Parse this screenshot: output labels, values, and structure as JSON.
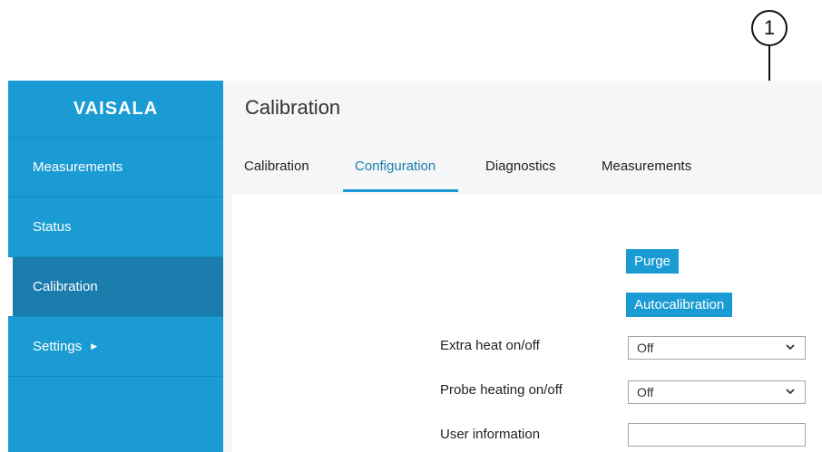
{
  "callout": {
    "number": "1"
  },
  "sidebar": {
    "logo": "VAISALA",
    "items": [
      {
        "label": "Measurements"
      },
      {
        "label": "Status"
      },
      {
        "label": "Calibration"
      },
      {
        "label": "Settings"
      }
    ]
  },
  "header": {
    "title": "Calibration"
  },
  "tabs": [
    {
      "label": "Calibration"
    },
    {
      "label": "Configuration"
    },
    {
      "label": "Diagnostics"
    },
    {
      "label": "Measurements"
    }
  ],
  "form": {
    "purge_label": "Purge",
    "autocalibration_label": "Autocalibration",
    "extra_heat": {
      "label": "Extra heat on/off",
      "value": "Off"
    },
    "probe_heating": {
      "label": "Probe heating on/off",
      "value": "Off"
    },
    "user_information": {
      "label": "User information",
      "value": ""
    }
  },
  "colors": {
    "accent": "#1a9bd3",
    "active_item": "#1a7cac"
  }
}
